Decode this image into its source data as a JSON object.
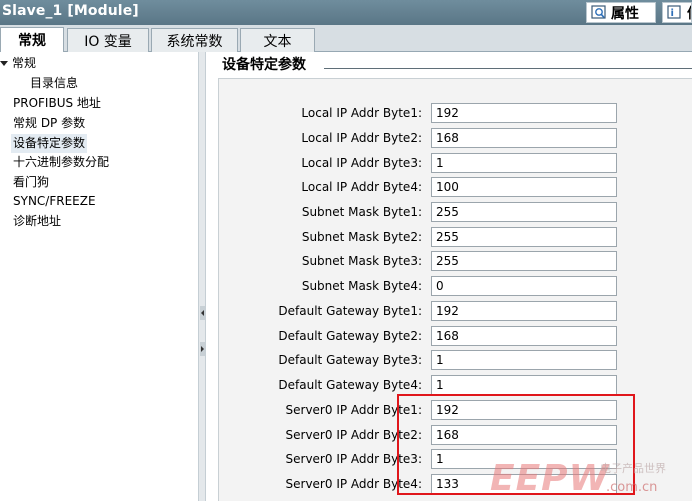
{
  "window": {
    "title": "Slave_1 [Module]"
  },
  "titlebar": {
    "properties_label": "属性",
    "info_label": "信"
  },
  "tabs": [
    {
      "label": "常规",
      "active": true
    },
    {
      "label": "IO 变量",
      "active": false
    },
    {
      "label": "系统常数",
      "active": false
    },
    {
      "label": "文本",
      "active": false
    }
  ],
  "nav": {
    "items": [
      {
        "label": "常规",
        "expanded": true,
        "selected": false
      },
      {
        "label": "目录信息",
        "selected": false
      },
      {
        "label": "PROFIBUS 地址",
        "selected": false
      },
      {
        "label": "常规 DP 参数",
        "selected": false
      },
      {
        "label": "设备特定参数",
        "selected": true
      },
      {
        "label": "十六进制参数分配",
        "selected": false
      },
      {
        "label": "看门狗",
        "selected": false
      },
      {
        "label": "SYNC/FREEZE",
        "selected": false
      },
      {
        "label": "诊断地址",
        "selected": false
      }
    ]
  },
  "main": {
    "section_title": "设备特定参数",
    "params": [
      {
        "label": "Local IP Addr Byte1:",
        "value": "192"
      },
      {
        "label": "Local IP Addr Byte2:",
        "value": "168"
      },
      {
        "label": "Local IP Addr Byte3:",
        "value": "1"
      },
      {
        "label": "Local IP Addr Byte4:",
        "value": "100"
      },
      {
        "label": "Subnet Mask Byte1:",
        "value": "255"
      },
      {
        "label": "Subnet Mask Byte2:",
        "value": "255"
      },
      {
        "label": "Subnet Mask Byte3:",
        "value": "255"
      },
      {
        "label": "Subnet Mask Byte4:",
        "value": "0"
      },
      {
        "label": "Default Gateway Byte1:",
        "value": "192"
      },
      {
        "label": "Default Gateway Byte2:",
        "value": "168"
      },
      {
        "label": "Default Gateway Byte3:",
        "value": "1"
      },
      {
        "label": "Default Gateway Byte4:",
        "value": "1"
      },
      {
        "label": "Server0 IP Addr Byte1:",
        "value": "192"
      },
      {
        "label": "Server0 IP Addr Byte2:",
        "value": "168"
      },
      {
        "label": "Server0 IP Addr Byte3:",
        "value": "1"
      },
      {
        "label": "Server0 IP Addr Byte4:",
        "value": "133"
      }
    ]
  },
  "annotation": {
    "highlight_color": "#e0161b"
  },
  "watermark": {
    "logo": "EEPW",
    "tagline": "电子产品世界",
    "url": ".com.cn"
  },
  "colors": {
    "titlebar_bg": "#5f7d8d",
    "selected_nav_bg": "#e3ebf2",
    "panel_bg": "#f3f3f3"
  }
}
